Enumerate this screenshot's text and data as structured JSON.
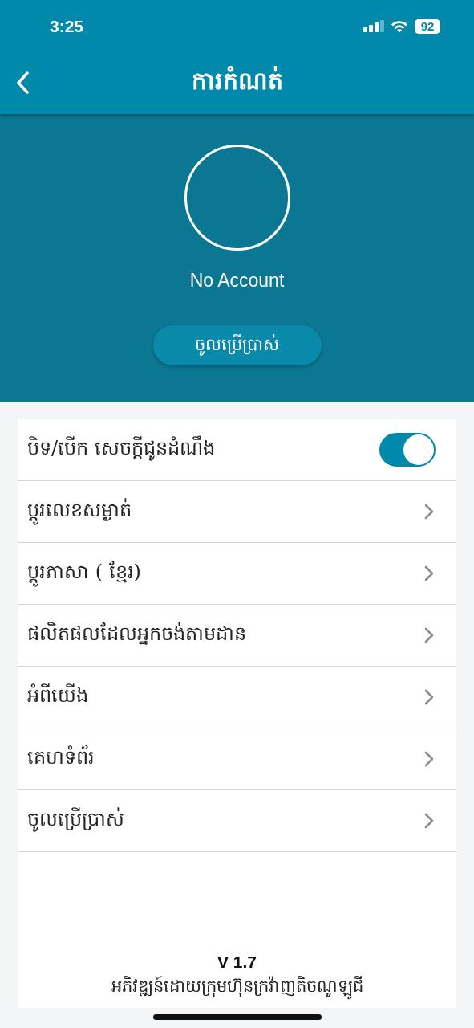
{
  "status_bar": {
    "time": "3:25",
    "battery": "92"
  },
  "header": {
    "title": "ការកំណត់"
  },
  "profile": {
    "name": "No Account",
    "login_button": "ចូលប្រើប្រាស់"
  },
  "settings": [
    {
      "kind": "toggle",
      "label": "បិទ/បើក សេចក្ដីជូនដំណឹង",
      "on": true
    },
    {
      "kind": "link",
      "label": "ប្ដូរលេខសម្ងាត់"
    },
    {
      "kind": "link",
      "label": "ប្ដូរភាសា ( ខ្មែរ)"
    },
    {
      "kind": "link",
      "label": "ផលិតផលដែលអ្នកចង់តាមដាន"
    },
    {
      "kind": "link",
      "label": "អំពីយើង"
    },
    {
      "kind": "link",
      "label": "គេហទំព័រ"
    },
    {
      "kind": "link",
      "label": "ចូលប្រើប្រាស់"
    }
  ],
  "footer": {
    "version": "V 1.7",
    "credit": "អភិវឌ្ឍន៍ដោយក្រុមហ៊ុនក្រវ៉ាញតិចណូឡូជី"
  }
}
